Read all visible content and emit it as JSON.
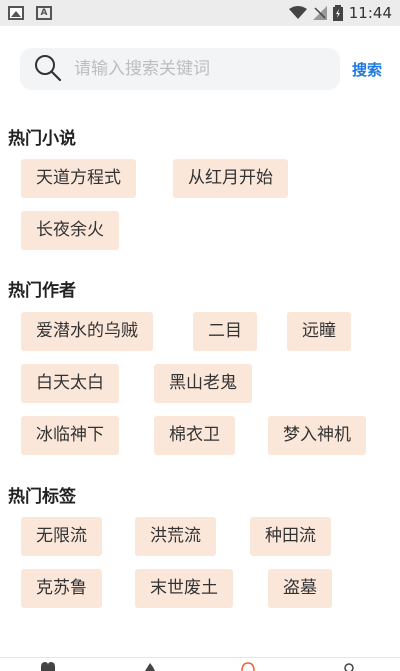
{
  "status_bar": {
    "time": "11:44"
  },
  "search": {
    "placeholder": "请输入搜索关键词",
    "value": "",
    "button": "搜索"
  },
  "sections": [
    {
      "title": "热门小说",
      "tags": [
        "天道方程式",
        "从红月开始",
        "长夜余火"
      ]
    },
    {
      "title": "热门作者",
      "tags": [
        "爱潜水的乌贼",
        "二目",
        "远瞳",
        "白天太白",
        "黑山老鬼",
        "冰临神下",
        "棉衣卫",
        "梦入神机"
      ]
    },
    {
      "title": "热门标签",
      "tags": [
        "无限流",
        "洪荒流",
        "种田流",
        "克苏鲁",
        "末世废土",
        "盗墓"
      ]
    }
  ],
  "colors": {
    "tag_bg": "#fbe7da",
    "accent": "#1f7ae0",
    "tab_active": "#e8643c"
  },
  "bottom_nav_icons": [
    "heart-icon",
    "flame-icon",
    "circle-icon",
    "person-icon"
  ]
}
